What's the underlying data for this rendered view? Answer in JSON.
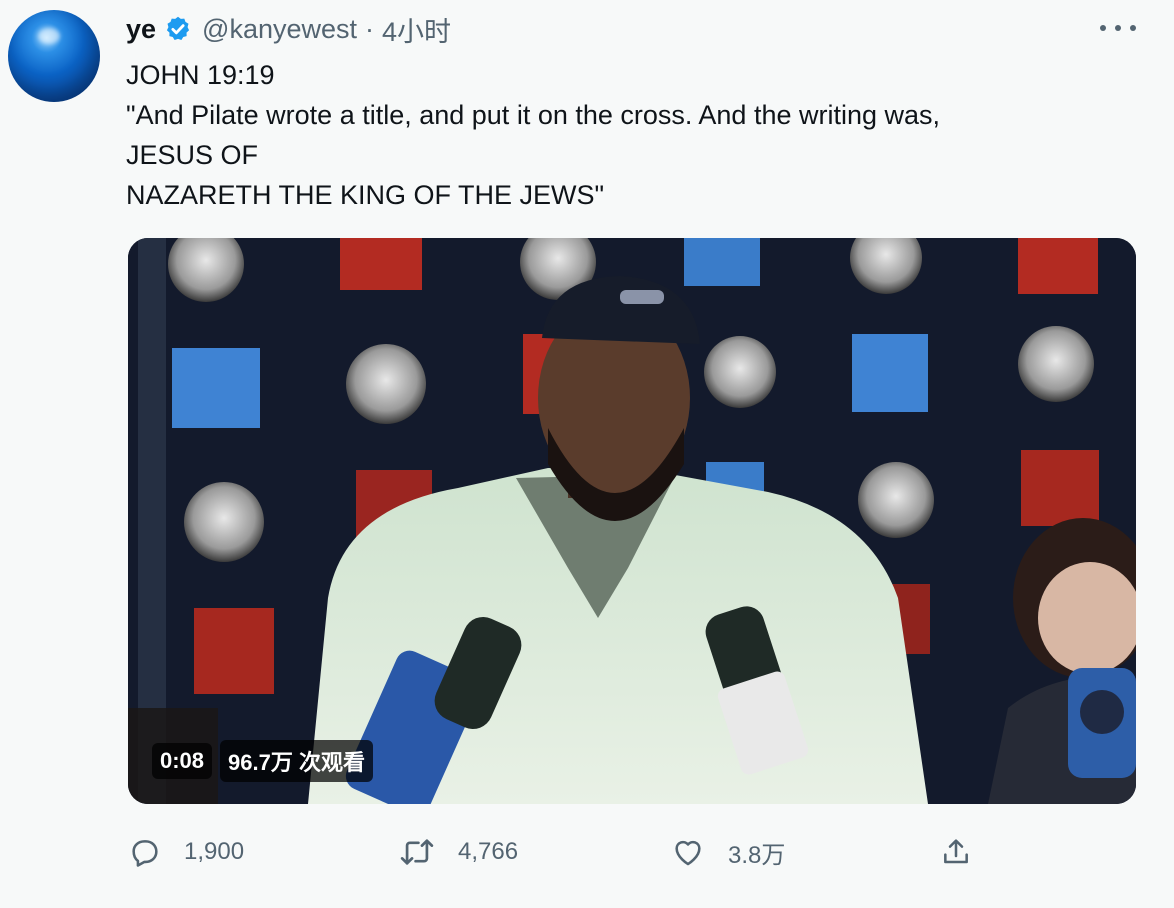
{
  "tweet": {
    "author_name": "ye",
    "handle": "@kanyewest",
    "separator": "·",
    "time": "4小时",
    "lines": [
      "JOHN 19:19",
      "\"And Pilate wrote a title, and put it on the cross. And the writing was,",
      "JESUS OF",
      "NAZARETH THE KING OF THE JEWS\""
    ]
  },
  "video": {
    "duration": "0:08",
    "views": "96.7万 次观看"
  },
  "actions": {
    "replies": "1,900",
    "retweets": "4,766",
    "likes": "3.8万"
  },
  "icons": {
    "verified": "verified-badge-icon",
    "more": "more-options-icon",
    "reply": "reply-icon",
    "retweet": "retweet-icon",
    "like": "heart-icon",
    "share": "share-icon"
  },
  "colors": {
    "verified_blue": "#1d9bf0",
    "secondary_text": "#536471",
    "primary_text": "#0f1419",
    "background": "#f7f9f9"
  }
}
